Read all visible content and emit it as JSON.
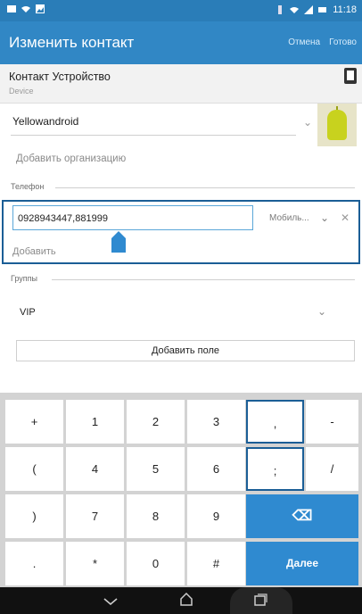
{
  "status": {
    "time": "11:18"
  },
  "app_bar": {
    "title": "Изменить контакт",
    "cancel": "Отмена",
    "done": "Готово"
  },
  "account": {
    "name": "Контакт Устройство",
    "type": "Device"
  },
  "name_field": {
    "value": "Yellowandroid"
  },
  "organization": {
    "add_label": "Добавить организацию"
  },
  "phone": {
    "section_label": "Телефон",
    "value": "0928943447,881999",
    "type": "Мобиль...",
    "add_label": "Добавить"
  },
  "groups": {
    "section_label": "Группы",
    "value": "VIP"
  },
  "add_field_button": "Добавить поле",
  "keyboard": {
    "rows": [
      [
        "+",
        "1",
        "2",
        "3",
        ",",
        "-"
      ],
      [
        "(",
        "4",
        "5",
        "6",
        ";",
        "/"
      ],
      [
        ")",
        "7",
        "8",
        "9",
        "⌫",
        ""
      ],
      [
        ".",
        "*",
        "0",
        "#",
        "Далее",
        ""
      ]
    ]
  },
  "colors": {
    "accent": "#3187c5",
    "status_bar": "#2a7db8",
    "key_action": "#2f8ad0",
    "highlight": "#1b5e96"
  },
  "icons": {
    "status_left": [
      "screenshot-icon",
      "wifi-icon",
      "image-icon"
    ],
    "status_right": [
      "vibrate-icon",
      "wifi-icon",
      "signal-icon",
      "battery-icon"
    ],
    "nav": [
      "back-icon",
      "home-icon",
      "recent-apps-icon"
    ]
  }
}
